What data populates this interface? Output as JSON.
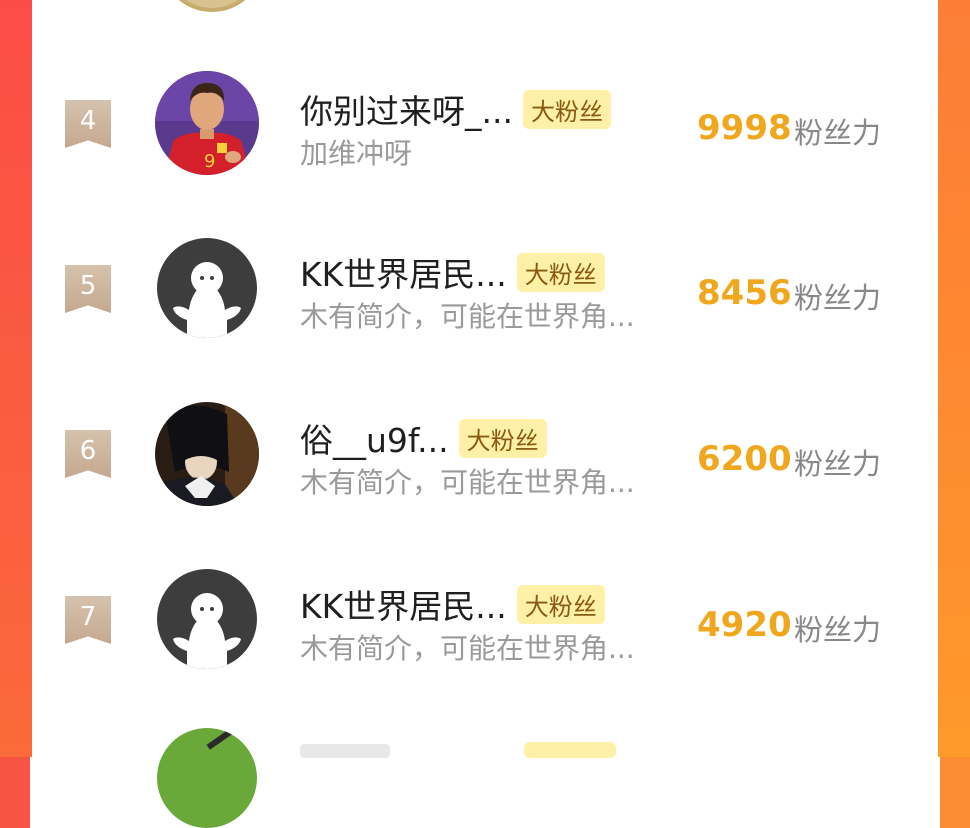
{
  "rows": [
    {
      "rank": "4",
      "name": "你别过来呀_...",
      "tag": "大粉丝",
      "bio": "加维冲呀",
      "score": "9998",
      "unit": "粉丝力",
      "avatar": "player-photo"
    },
    {
      "rank": "5",
      "name": "KK世界居民...",
      "tag": "大粉丝",
      "bio": "木有简介，可能在世界角...",
      "score": "8456",
      "unit": "粉丝力",
      "avatar": "default-ghost"
    },
    {
      "rank": "6",
      "name": "俗__u9f...",
      "tag": "大粉丝",
      "bio": "木有简介，可能在世界角...",
      "score": "6200",
      "unit": "粉丝力",
      "avatar": "anime-photo"
    },
    {
      "rank": "7",
      "name": "KK世界居民...",
      "tag": "大粉丝",
      "bio": "木有简介，可能在世界角...",
      "score": "4920",
      "unit": "粉丝力",
      "avatar": "default-ghost"
    }
  ],
  "colors": {
    "accent": "#f0a71e",
    "tag_bg": "#fff0a8",
    "left_border": "#fb4d46",
    "right_border": "#fe8c30"
  }
}
